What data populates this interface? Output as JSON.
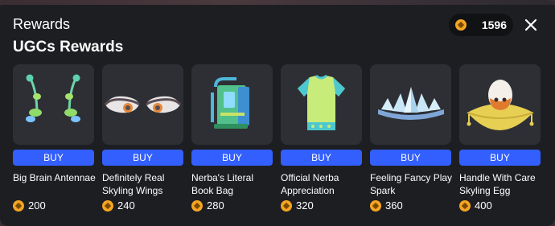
{
  "header": {
    "title": "Rewards",
    "subtitle": "UGCs Rewards",
    "balance": "1596",
    "balance_icon": "robux-coin-icon",
    "close_icon": "close-icon"
  },
  "colors": {
    "panel_bg": "#1d1e22",
    "card_bg": "#2d2f35",
    "buy_button": "#335fff",
    "coin": "#f5a524"
  },
  "items": [
    {
      "name": "Big Brain Antennae",
      "price": "200",
      "buy_label": "BUY",
      "icon": "antennae-icon"
    },
    {
      "name": "Definitely Real Skyling Wings",
      "price": "240",
      "buy_label": "BUY",
      "icon": "wings-icon"
    },
    {
      "name": "Nerba's Literal Book Bag",
      "price": "280",
      "buy_label": "BUY",
      "icon": "book-bag-icon"
    },
    {
      "name": "Official Nerba Appreciation",
      "price": "320",
      "buy_label": "BUY",
      "icon": "shirt-icon"
    },
    {
      "name": "Feeling Fancy Play Spark",
      "price": "360",
      "buy_label": "BUY",
      "icon": "crown-icon"
    },
    {
      "name": "Handle With Care Skyling Egg",
      "price": "400",
      "buy_label": "BUY",
      "icon": "egg-on-pillow-icon"
    }
  ]
}
